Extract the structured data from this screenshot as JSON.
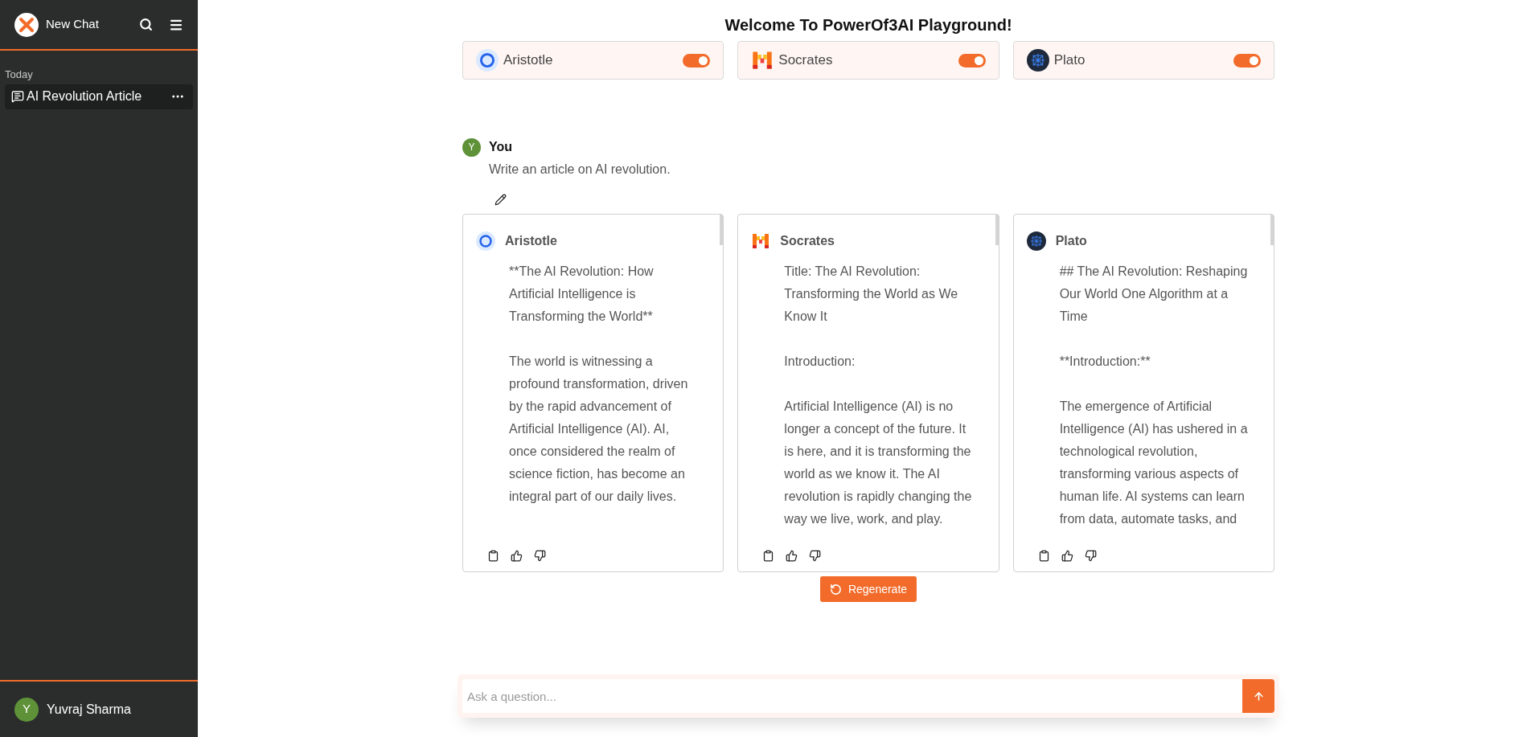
{
  "sidebar": {
    "new_chat": "New Chat",
    "section": "Today",
    "chats": [
      {
        "title": "AI Revolution Article",
        "selected": true
      }
    ],
    "user": {
      "initial": "Y",
      "name": "Yuvraj Sharma"
    }
  },
  "title": "Welcome To PowerOf3AI Playground!",
  "models": [
    {
      "kind": "ring",
      "name": "Aristotle",
      "on": true
    },
    {
      "kind": "pixel",
      "name": "Socrates",
      "on": true
    },
    {
      "kind": "network",
      "name": "Plato",
      "on": true
    }
  ],
  "message": {
    "initial": "Y",
    "author": "You",
    "text": "Write an article on AI revolution."
  },
  "responses": [
    {
      "kind": "ring",
      "name": "Aristotle",
      "paragraphs": [
        "**The AI Revolution: How Artificial Intelligence is Transforming the World**",
        "The world is witnessing a profound transformation, driven by the rapid advancement of Artificial Intelligence (AI). AI, once considered the realm of science fiction, has become an integral part of our daily lives."
      ]
    },
    {
      "kind": "pixel",
      "name": "Socrates",
      "paragraphs": [
        "Title: The AI Revolution: Transforming the World as We Know It",
        "Introduction:",
        "Artificial Intelligence (AI) is no longer a concept of the future. It is here, and it is transforming the world as we know it. The AI revolution is rapidly changing the way we live, work, and play."
      ]
    },
    {
      "kind": "network",
      "name": "Plato",
      "paragraphs": [
        "## The AI Revolution: Reshaping Our World One Algorithm at a Time",
        "**Introduction:**",
        "The emergence of Artificial Intelligence (AI) has ushered in a technological revolution, transforming various aspects of human life. AI systems can learn from data, automate tasks, and"
      ]
    }
  ],
  "regenerate": "Regenerate",
  "input": {
    "placeholder": "Ask a question..."
  }
}
